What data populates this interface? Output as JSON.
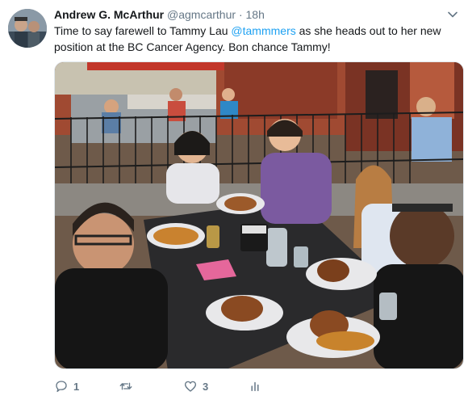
{
  "tweet": {
    "author_name": "Andrew G. McArthur",
    "handle": "@agmcarthur",
    "separator": "·",
    "time": "18h",
    "text_before": "Time to say farewell to Tammy Lau ",
    "mention": "@tammmers",
    "text_after": " as she heads out to her new position at the BC Cancer Agency. Bon chance Tammy!",
    "photo_icon": "restaurant-patio-group-photo"
  },
  "actions": {
    "reply_count": "1",
    "retweet_count": "",
    "like_count": "3",
    "reply_icon": "reply-icon",
    "retweet_icon": "retweet-icon",
    "like_icon": "heart-icon",
    "analytics_icon": "analytics-icon"
  },
  "colors": {
    "link": "#1da1f2",
    "secondary_text": "#657786",
    "primary_text": "#14171a"
  }
}
